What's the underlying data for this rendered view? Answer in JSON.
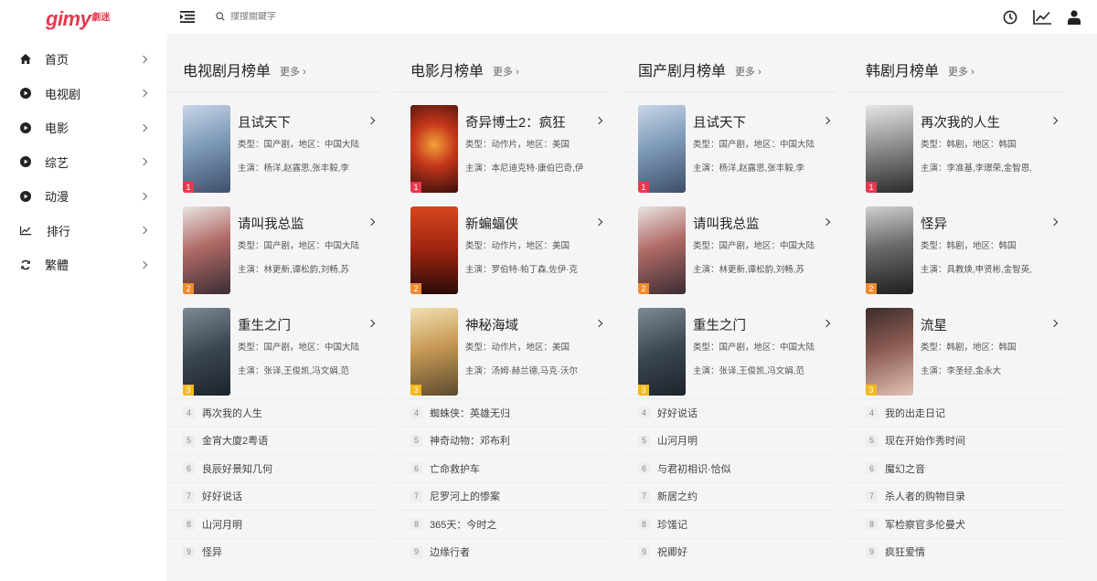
{
  "logo": {
    "main": "gimy",
    "sub": "劇迷"
  },
  "sidebar": {
    "items": [
      {
        "label": "首页",
        "icon": "home-icon"
      },
      {
        "label": "电视剧",
        "icon": "play-circle-icon"
      },
      {
        "label": "电影",
        "icon": "play-circle-icon"
      },
      {
        "label": "综艺",
        "icon": "play-circle-icon"
      },
      {
        "label": "动漫",
        "icon": "play-circle-icon"
      },
      {
        "label": "排行",
        "icon": "trend-chart-icon"
      },
      {
        "label": "繁體",
        "icon": "refresh-icon"
      }
    ]
  },
  "topbar": {
    "search_placeholder": "搜搜關鍵字"
  },
  "colors": {
    "brand": "#e8384f",
    "rank1": "#e8384f",
    "rank2": "#f08c2e",
    "rank3": "#f5b91c"
  },
  "columns": [
    {
      "title": "电视剧月榜单",
      "more": "更多 ›",
      "top": [
        {
          "rank": "1",
          "title": "且试天下",
          "meta": "类型：国产剧，地区：中国大陆",
          "stars": "主演：杨洋,赵露思,张丰毅,李"
        },
        {
          "rank": "2",
          "title": "请叫我总监",
          "meta": "类型：国产剧，地区：中国大陆",
          "stars": "主演：林更新,谭松韵,刘畅,苏"
        },
        {
          "rank": "3",
          "title": "重生之门",
          "meta": "类型：国产剧，地区：中国大陆",
          "stars": "主演：张译,王俊凯,冯文娟,范"
        }
      ],
      "list": [
        {
          "rank": "4",
          "title": "再次我的人生"
        },
        {
          "rank": "5",
          "title": "金宵大廈2粤语"
        },
        {
          "rank": "6",
          "title": "良辰好景知几何"
        },
        {
          "rank": "7",
          "title": "好好说话"
        },
        {
          "rank": "8",
          "title": "山河月明"
        },
        {
          "rank": "9",
          "title": "怪异"
        }
      ]
    },
    {
      "title": "电影月榜单",
      "more": "更多 ›",
      "top": [
        {
          "rank": "1",
          "title": "奇异博士2：疯狂",
          "meta": "类型：动作片，地区：美国",
          "stars": "主演：本尼迪克特·康伯巴奇,伊"
        },
        {
          "rank": "2",
          "title": "新蝙蝠侠",
          "meta": "类型：动作片，地区：美国",
          "stars": "主演：罗伯特·帕丁森,佐伊·克"
        },
        {
          "rank": "3",
          "title": "神秘海域",
          "meta": "类型：动作片，地区：美国",
          "stars": "主演：汤姆·赫兰德,马克·沃尔"
        }
      ],
      "list": [
        {
          "rank": "4",
          "title": "蜘蛛侠：英雄无归"
        },
        {
          "rank": "5",
          "title": "神奇动物：邓布利"
        },
        {
          "rank": "6",
          "title": "亡命救护车"
        },
        {
          "rank": "7",
          "title": "尼罗河上的惨案"
        },
        {
          "rank": "8",
          "title": "365天：今时之"
        },
        {
          "rank": "9",
          "title": "边缘行者"
        }
      ]
    },
    {
      "title": "国产剧月榜单",
      "more": "更多 ›",
      "top": [
        {
          "rank": "1",
          "title": "且试天下",
          "meta": "类型：国产剧，地区：中国大陆",
          "stars": "主演：杨洋,赵露思,张丰毅,李"
        },
        {
          "rank": "2",
          "title": "请叫我总监",
          "meta": "类型：国产剧，地区：中国大陆",
          "stars": "主演：林更新,谭松韵,刘畅,苏"
        },
        {
          "rank": "3",
          "title": "重生之门",
          "meta": "类型：国产剧，地区：中国大陆",
          "stars": "主演：张译,王俊凯,冯文娟,范"
        }
      ],
      "list": [
        {
          "rank": "4",
          "title": "好好说话"
        },
        {
          "rank": "5",
          "title": "山河月明"
        },
        {
          "rank": "6",
          "title": "与君初相识·恰似"
        },
        {
          "rank": "7",
          "title": "新居之约"
        },
        {
          "rank": "8",
          "title": "珍馐记"
        },
        {
          "rank": "9",
          "title": "祝卿好"
        }
      ]
    },
    {
      "title": "韩剧月榜单",
      "more": "更多 ›",
      "top": [
        {
          "rank": "1",
          "title": "再次我的人生",
          "meta": "类型：韩剧，地区：韩国",
          "stars": "主演：李准基,李璟荣,金智恩,"
        },
        {
          "rank": "2",
          "title": "怪异",
          "meta": "类型：韩剧，地区：韩国",
          "stars": "主演：具教焕,申贤彬,金智英,"
        },
        {
          "rank": "3",
          "title": "流星",
          "meta": "类型：韩剧，地区：韩国",
          "stars": "主演：李圣经,金永大"
        }
      ],
      "list": [
        {
          "rank": "4",
          "title": "我的出走日记"
        },
        {
          "rank": "5",
          "title": "现在开始作秀时间"
        },
        {
          "rank": "6",
          "title": "魔幻之音"
        },
        {
          "rank": "7",
          "title": "杀人者的购物目录"
        },
        {
          "rank": "8",
          "title": "军检察官多伦曼犬"
        },
        {
          "rank": "9",
          "title": "疯狂爱情"
        }
      ]
    }
  ]
}
